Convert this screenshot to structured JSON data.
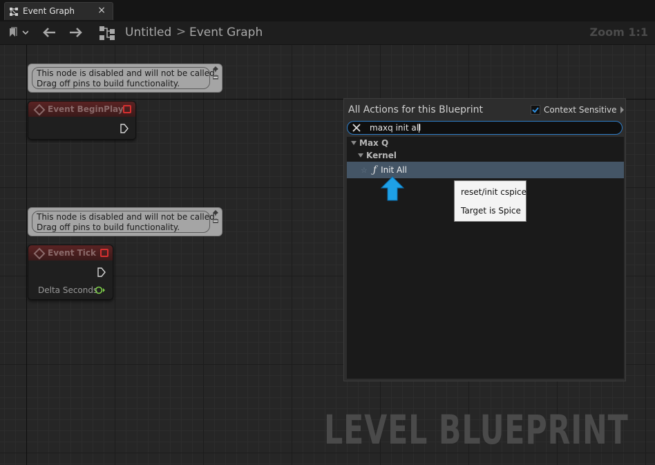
{
  "tab": {
    "title": "Event Graph",
    "close": "×"
  },
  "breadcrumb": {
    "root": "Untitled",
    "separator": ">",
    "current": "Event Graph"
  },
  "zoom_label": "Zoom 1:1",
  "comments": [
    {
      "line1": "This node is disabled and will not be called.",
      "line2": "Drag off pins to build functionality."
    },
    {
      "line1": "This node is disabled and will not be called.",
      "line2": "Drag off pins to build functionality."
    }
  ],
  "nodes": {
    "begin_play": {
      "title": "Event BeginPlay"
    },
    "tick": {
      "title": "Event Tick",
      "output_label": "Delta Seconds"
    }
  },
  "action_menu": {
    "title": "All Actions for this Blueprint",
    "context_sensitive": {
      "label": "Context Sensitive",
      "checked": true
    },
    "search_value": "maxq init all",
    "categories": [
      "Max Q",
      "Kernel"
    ],
    "selected_action": "Init All"
  },
  "tooltip": {
    "line1": "reset/init cspice",
    "line2": "Target is Spice"
  },
  "watermark": "LEVEL BLUEPRINT",
  "colors": {
    "accent": "#2f7ec9",
    "selection": "#445566",
    "annotation_arrow": "#1ea0e6"
  },
  "icons": [
    "graph-tab-icon",
    "bookmark-icon",
    "back-arrow-icon",
    "forward-arrow-icon",
    "graph-icon",
    "pin-icon",
    "diamond-event-icon",
    "exec-pin-icon",
    "float-pin-icon",
    "checkmark-icon",
    "close-icon",
    "star-icon",
    "function-icon",
    "up-arrow-icon"
  ]
}
